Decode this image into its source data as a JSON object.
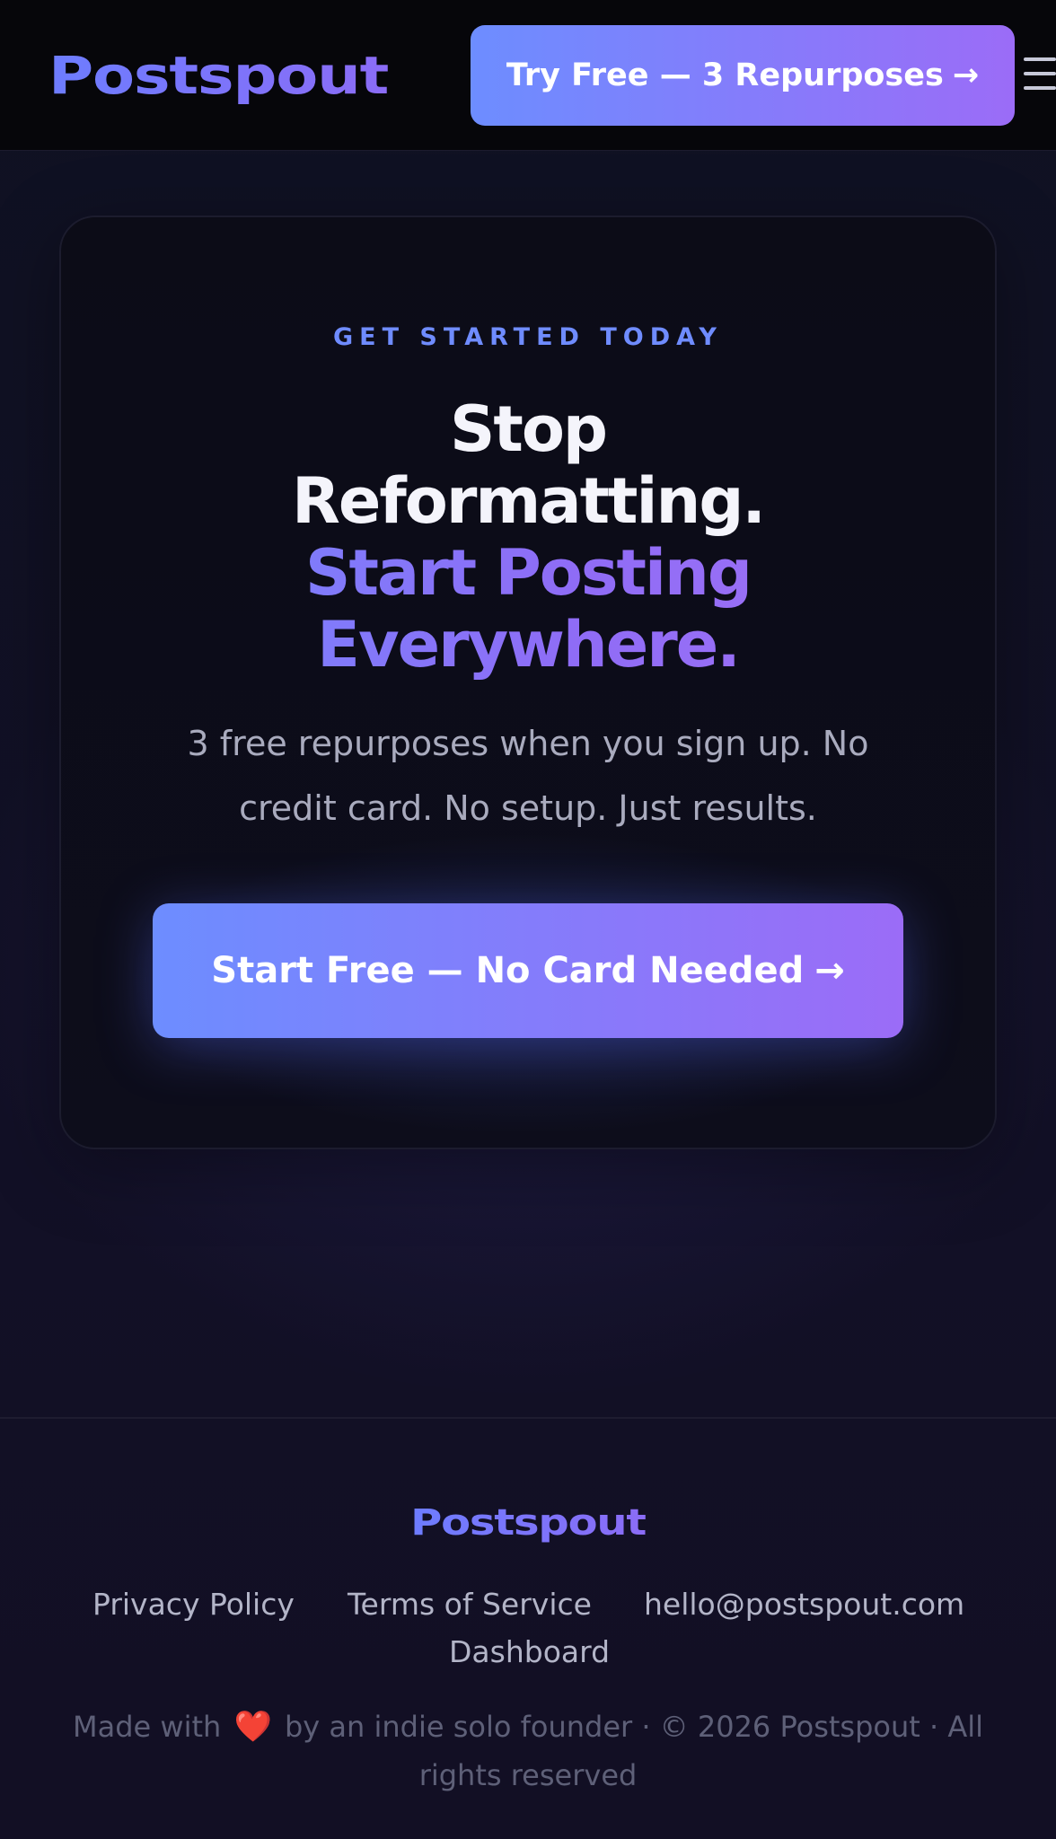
{
  "header": {
    "brand": "Postspout",
    "cta_label": "Try Free — 3 Repurposes",
    "cta_arrow": "→"
  },
  "hero": {
    "eyebrow": "GET STARTED TODAY",
    "headline_line1": "Stop",
    "headline_line2": "Reformatting.",
    "headline_line3": "Start Posting",
    "headline_line4": "Everywhere.",
    "subtitle": "3 free repurposes when you sign up. No credit card. No setup. Just results.",
    "cta_label": "Start Free — No Card Needed",
    "cta_arrow": "→"
  },
  "footer": {
    "brand": "Postspout",
    "links": {
      "privacy": "Privacy Policy",
      "terms": "Terms of Service",
      "email": "hello@postspout.com",
      "dashboard": "Dashboard"
    },
    "made_with": "Made with",
    "heart": "❤️",
    "copyright_rest": "by an indie solo founder · © 2026 Postspout · All rights reserved"
  },
  "colors": {
    "accent_blue": "#6d8dff",
    "accent_purple": "#9b6cf7",
    "background": "#100f20",
    "header_bg": "#06060a"
  },
  "icons": {
    "menu": "hamburger-menu-icon",
    "arrow": "arrow-right-icon",
    "heart": "heart-icon"
  }
}
